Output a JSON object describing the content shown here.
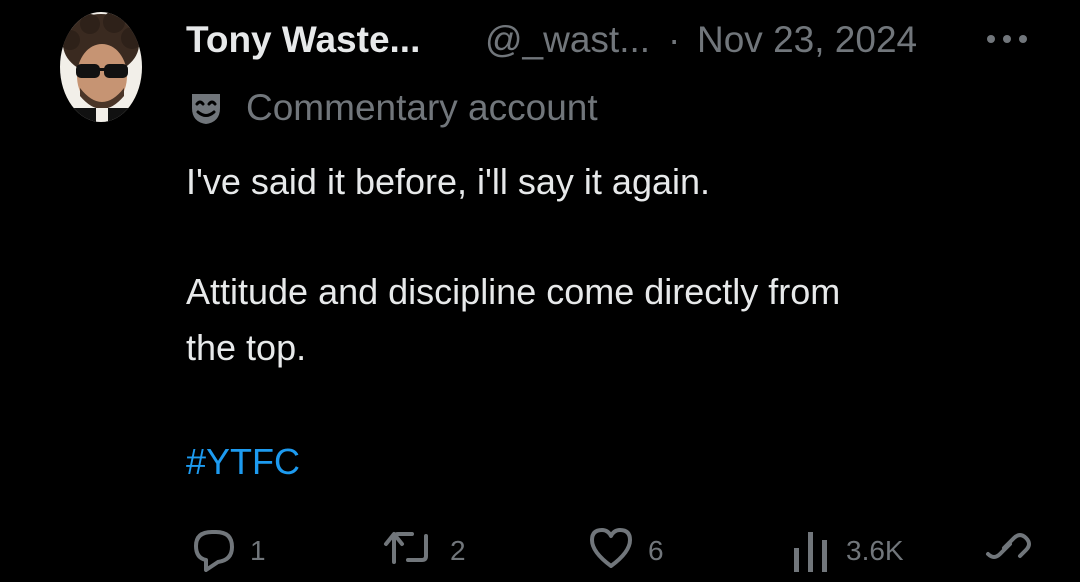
{
  "tweet": {
    "author_name": "Tony Waste...",
    "handle": "@_wast...",
    "separator": "·",
    "date": "Nov 23, 2024",
    "label_icon": "theater-mask-icon",
    "label": "Commentary account",
    "lines": [
      "I've said it before, i'll say it again.",
      "Attitude and discipline come directly from",
      "the top."
    ],
    "hashtag": "#YTFC"
  },
  "actions": {
    "reply_count": "1",
    "retweet_count": "2",
    "like_count": "6",
    "views_count": "3.6K"
  },
  "colors": {
    "background": "#000000",
    "primary_text": "#e7e9ea",
    "secondary_text": "#71767b",
    "link": "#1d9bf0"
  }
}
